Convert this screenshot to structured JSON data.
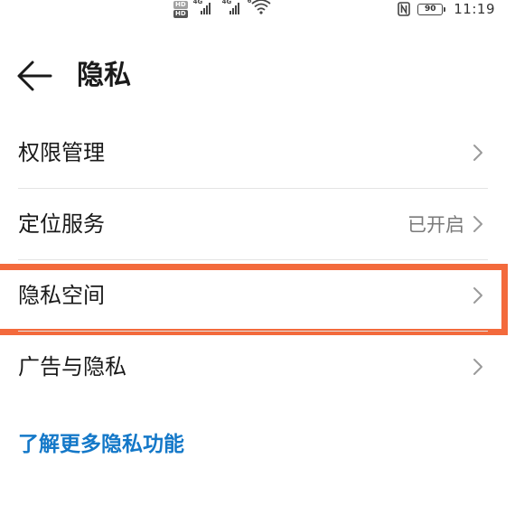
{
  "status_bar": {
    "hd_badges": [
      "HD",
      "HD"
    ],
    "signal_labels": [
      "4G",
      "4G"
    ],
    "wifi_label": "6",
    "icons": [
      "hd-icon",
      "signal-icon",
      "signal-icon",
      "wifi-icon",
      "nfc-icon",
      "battery-icon"
    ],
    "battery_level": "90",
    "time": "11:19"
  },
  "header": {
    "back_icon": "arrow-left-icon",
    "title": "隐私"
  },
  "list": {
    "items": [
      {
        "label": "权限管理",
        "value": "",
        "icon": "chevron-right-icon"
      },
      {
        "label": "定位服务",
        "value": "已开启",
        "icon": "chevron-right-icon"
      },
      {
        "label": "隐私空间",
        "value": "",
        "icon": "chevron-right-icon",
        "highlighted": true
      },
      {
        "label": "广告与隐私",
        "value": "",
        "icon": "chevron-right-icon"
      }
    ]
  },
  "learn_more_link": "了解更多隐私功能",
  "colors": {
    "highlight_border": "#f36a3c",
    "link": "#1478c8",
    "text_primary": "#1a1a1a",
    "text_secondary": "#7a7a7a"
  }
}
